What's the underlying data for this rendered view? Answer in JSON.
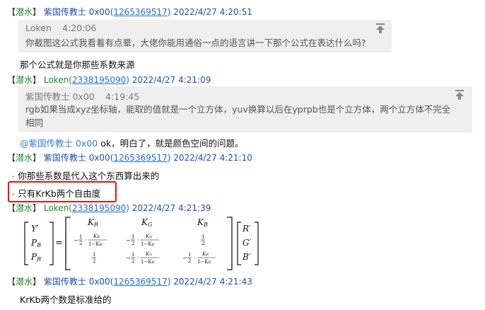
{
  "colors": {
    "tag_green": "#1f8a2e",
    "name_blue": "#1f4fb3",
    "qq_link": "#1f6fd6",
    "quote_bg": "#efefef",
    "highlight_red": "#e11"
  },
  "messages": [
    {
      "tag_open": "【",
      "tag_text": "潜水",
      "tag_close": "】",
      "name": "紫国传教士 0x00",
      "qq": "1265369517",
      "time": "2022/4/27 4:20:51",
      "quote": {
        "name": "Loken",
        "time": "4:20:06",
        "text": "你截图这公式我看着有点晕，大佬你能用通俗一点的语言讲一下那个公式在表达什么吗?"
      },
      "body": "那个公式就是你那些系数来源"
    },
    {
      "tag_open": "【",
      "tag_text": "潜水",
      "tag_close": "】",
      "name": "Loken",
      "qq": "2338195090",
      "time": "2022/4/27 4:21:09",
      "quote": {
        "name": "紫国传教士 0x00",
        "time": "4:19:45",
        "text1": "rgb如果当成xyz坐标轴，能取的值就是一个立方体，yuv换算以后在yprpb也是个立方体，两个立方体不完全",
        "text2": "相同"
      },
      "mention": "@紫国传教士 0x00",
      "body": " ok，明白了，就是颜色空间的问题。"
    },
    {
      "tag_open": "【",
      "tag_text": "潜水",
      "tag_close": "】",
      "name": "紫国传教士 0x00",
      "qq": "1265369517",
      "time": "2022/4/27 4:21:10",
      "lines": [
        "你那些系数是代入这个东西算出来的",
        "只有KrKb两个自由度"
      ]
    },
    {
      "tag_open": "【",
      "tag_text": "潜水",
      "tag_close": "】",
      "name": "Loken",
      "qq": "2338195090",
      "time": "2022/4/27 4:21:39"
    },
    {
      "tag_open": "【",
      "tag_text": "潜水",
      "tag_close": "】",
      "name": "紫国传教士 0x00",
      "qq": "1265369517",
      "time": "2022/4/27 4:21:43",
      "body": "KrKb两个数是标准给的"
    }
  ],
  "icons": {
    "pin": "pin-top-icon"
  }
}
